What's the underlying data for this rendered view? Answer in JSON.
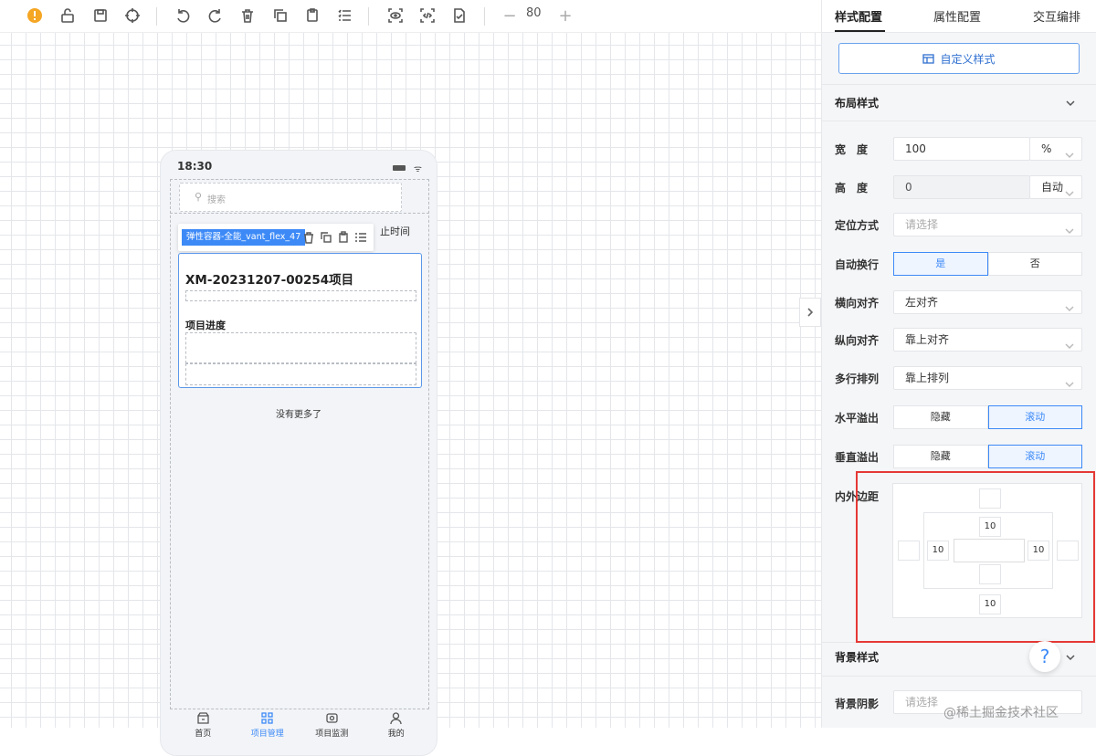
{
  "toolbar": {
    "zoom_value": "80",
    "zoom_minus": "−",
    "zoom_plus": "+"
  },
  "phone": {
    "time": "18:30",
    "search_placeholder": "搜索",
    "selection_tag": "弹性容器-全能_vant_flex_47",
    "end_time_label": "止时间",
    "card_title": "XM-20231207-00254项目",
    "progress_label": "项目进度",
    "no_more": "没有更多了",
    "tabs": [
      {
        "label": "首页",
        "icon": "home-icon",
        "active": false
      },
      {
        "label": "项目管理",
        "icon": "grid-icon",
        "active": true
      },
      {
        "label": "项目监测",
        "icon": "monitor-icon",
        "active": false
      },
      {
        "label": "我的",
        "icon": "user-icon",
        "active": false
      }
    ]
  },
  "panel": {
    "tabs": [
      "样式配置",
      "属性配置",
      "交互编排"
    ],
    "custom_style_button": "自定义样式",
    "layout_section": "布局样式",
    "fields": {
      "width_label": "宽　度",
      "width_value": "100",
      "width_unit": "%",
      "height_label": "高　度",
      "height_value": "0",
      "height_unit": "自动",
      "position_label": "定位方式",
      "position_placeholder": "请选择",
      "wrap_label": "自动换行",
      "wrap_yes": "是",
      "wrap_no": "否",
      "h_align_label": "横向对齐",
      "h_align_value": "左对齐",
      "v_align_label": "纵向对齐",
      "v_align_value": "靠上对齐",
      "multi_label": "多行排列",
      "multi_value": "靠上排列",
      "h_overflow_label": "水平溢出",
      "v_overflow_label": "垂直溢出",
      "overflow_hidden": "隐藏",
      "overflow_scroll": "滚动",
      "spacing_label": "内外边距"
    },
    "box_model": {
      "padding_top": "10",
      "padding_left": "10",
      "padding_right": "10",
      "padding_bottom": "10"
    },
    "background_section": "背景样式",
    "shadow_label": "背景阴影",
    "shadow_placeholder": "请选择"
  },
  "help": "?",
  "watermark": "@稀土掘金技术社区",
  "colors": {
    "accent": "#3d8af7",
    "highlight": "#e53935"
  }
}
